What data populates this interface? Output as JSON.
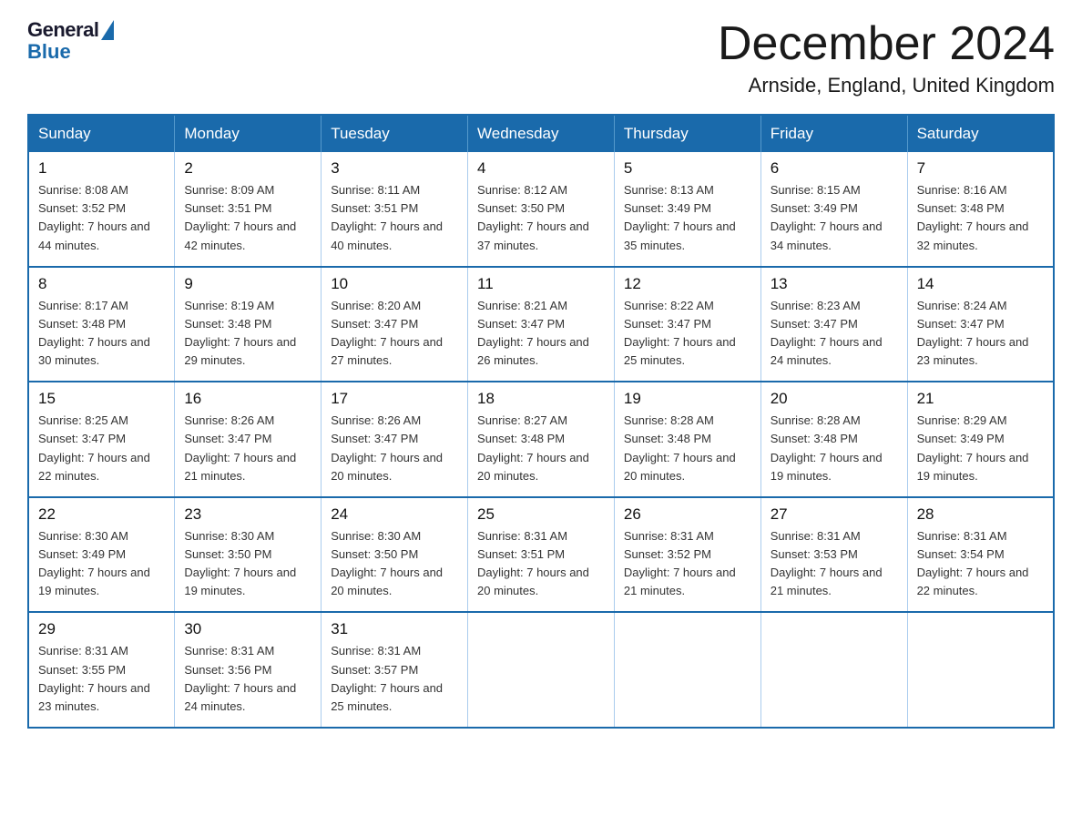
{
  "header": {
    "logo_general": "General",
    "logo_blue": "Blue",
    "month_title": "December 2024",
    "location": "Arnside, England, United Kingdom"
  },
  "weekdays": [
    "Sunday",
    "Monday",
    "Tuesday",
    "Wednesday",
    "Thursday",
    "Friday",
    "Saturday"
  ],
  "weeks": [
    [
      {
        "day": "1",
        "sunrise": "8:08 AM",
        "sunset": "3:52 PM",
        "daylight": "7 hours and 44 minutes."
      },
      {
        "day": "2",
        "sunrise": "8:09 AM",
        "sunset": "3:51 PM",
        "daylight": "7 hours and 42 minutes."
      },
      {
        "day": "3",
        "sunrise": "8:11 AM",
        "sunset": "3:51 PM",
        "daylight": "7 hours and 40 minutes."
      },
      {
        "day": "4",
        "sunrise": "8:12 AM",
        "sunset": "3:50 PM",
        "daylight": "7 hours and 37 minutes."
      },
      {
        "day": "5",
        "sunrise": "8:13 AM",
        "sunset": "3:49 PM",
        "daylight": "7 hours and 35 minutes."
      },
      {
        "day": "6",
        "sunrise": "8:15 AM",
        "sunset": "3:49 PM",
        "daylight": "7 hours and 34 minutes."
      },
      {
        "day": "7",
        "sunrise": "8:16 AM",
        "sunset": "3:48 PM",
        "daylight": "7 hours and 32 minutes."
      }
    ],
    [
      {
        "day": "8",
        "sunrise": "8:17 AM",
        "sunset": "3:48 PM",
        "daylight": "7 hours and 30 minutes."
      },
      {
        "day": "9",
        "sunrise": "8:19 AM",
        "sunset": "3:48 PM",
        "daylight": "7 hours and 29 minutes."
      },
      {
        "day": "10",
        "sunrise": "8:20 AM",
        "sunset": "3:47 PM",
        "daylight": "7 hours and 27 minutes."
      },
      {
        "day": "11",
        "sunrise": "8:21 AM",
        "sunset": "3:47 PM",
        "daylight": "7 hours and 26 minutes."
      },
      {
        "day": "12",
        "sunrise": "8:22 AM",
        "sunset": "3:47 PM",
        "daylight": "7 hours and 25 minutes."
      },
      {
        "day": "13",
        "sunrise": "8:23 AM",
        "sunset": "3:47 PM",
        "daylight": "7 hours and 24 minutes."
      },
      {
        "day": "14",
        "sunrise": "8:24 AM",
        "sunset": "3:47 PM",
        "daylight": "7 hours and 23 minutes."
      }
    ],
    [
      {
        "day": "15",
        "sunrise": "8:25 AM",
        "sunset": "3:47 PM",
        "daylight": "7 hours and 22 minutes."
      },
      {
        "day": "16",
        "sunrise": "8:26 AM",
        "sunset": "3:47 PM",
        "daylight": "7 hours and 21 minutes."
      },
      {
        "day": "17",
        "sunrise": "8:26 AM",
        "sunset": "3:47 PM",
        "daylight": "7 hours and 20 minutes."
      },
      {
        "day": "18",
        "sunrise": "8:27 AM",
        "sunset": "3:48 PM",
        "daylight": "7 hours and 20 minutes."
      },
      {
        "day": "19",
        "sunrise": "8:28 AM",
        "sunset": "3:48 PM",
        "daylight": "7 hours and 20 minutes."
      },
      {
        "day": "20",
        "sunrise": "8:28 AM",
        "sunset": "3:48 PM",
        "daylight": "7 hours and 19 minutes."
      },
      {
        "day": "21",
        "sunrise": "8:29 AM",
        "sunset": "3:49 PM",
        "daylight": "7 hours and 19 minutes."
      }
    ],
    [
      {
        "day": "22",
        "sunrise": "8:30 AM",
        "sunset": "3:49 PM",
        "daylight": "7 hours and 19 minutes."
      },
      {
        "day": "23",
        "sunrise": "8:30 AM",
        "sunset": "3:50 PM",
        "daylight": "7 hours and 19 minutes."
      },
      {
        "day": "24",
        "sunrise": "8:30 AM",
        "sunset": "3:50 PM",
        "daylight": "7 hours and 20 minutes."
      },
      {
        "day": "25",
        "sunrise": "8:31 AM",
        "sunset": "3:51 PM",
        "daylight": "7 hours and 20 minutes."
      },
      {
        "day": "26",
        "sunrise": "8:31 AM",
        "sunset": "3:52 PM",
        "daylight": "7 hours and 21 minutes."
      },
      {
        "day": "27",
        "sunrise": "8:31 AM",
        "sunset": "3:53 PM",
        "daylight": "7 hours and 21 minutes."
      },
      {
        "day": "28",
        "sunrise": "8:31 AM",
        "sunset": "3:54 PM",
        "daylight": "7 hours and 22 minutes."
      }
    ],
    [
      {
        "day": "29",
        "sunrise": "8:31 AM",
        "sunset": "3:55 PM",
        "daylight": "7 hours and 23 minutes."
      },
      {
        "day": "30",
        "sunrise": "8:31 AM",
        "sunset": "3:56 PM",
        "daylight": "7 hours and 24 minutes."
      },
      {
        "day": "31",
        "sunrise": "8:31 AM",
        "sunset": "3:57 PM",
        "daylight": "7 hours and 25 minutes."
      },
      null,
      null,
      null,
      null
    ]
  ]
}
